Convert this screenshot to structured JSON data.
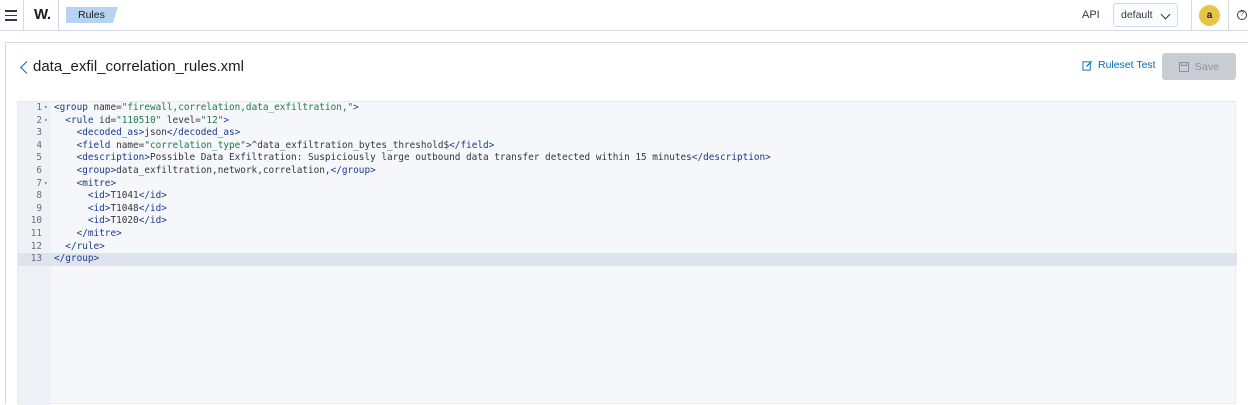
{
  "header": {
    "logo": "W.",
    "breadcrumb": "Rules",
    "api_label": "API",
    "selected_api": "default",
    "avatar_letter": "a",
    "help_glyph": "?"
  },
  "file": {
    "title": "data_exfil_correlation_rules.xml",
    "ruleset_test_label": "Ruleset Test",
    "save_label": "Save"
  },
  "editor": {
    "active_line": 13,
    "lines": [
      {
        "n": "1",
        "fold": true,
        "tokens": [
          [
            "tag",
            "<group "
          ],
          [
            "attr",
            "name="
          ],
          [
            "str",
            "\"firewall,correlation,data_exfiltration,\""
          ],
          [
            "tag",
            ">"
          ]
        ]
      },
      {
        "n": "2",
        "fold": true,
        "tokens": [
          [
            "txt",
            "  "
          ],
          [
            "tag",
            "<rule "
          ],
          [
            "attr",
            "id="
          ],
          [
            "str",
            "\"110510\""
          ],
          [
            "attr",
            " level="
          ],
          [
            "str",
            "\"12\""
          ],
          [
            "tag",
            ">"
          ]
        ]
      },
      {
        "n": "3",
        "fold": false,
        "tokens": [
          [
            "txt",
            "    "
          ],
          [
            "tag",
            "<decoded_as>"
          ],
          [
            "txt",
            "json"
          ],
          [
            "tag",
            "</decoded_as>"
          ]
        ]
      },
      {
        "n": "4",
        "fold": false,
        "tokens": [
          [
            "txt",
            "    "
          ],
          [
            "tag",
            "<field "
          ],
          [
            "attr",
            "name="
          ],
          [
            "str",
            "\"correlation_type\""
          ],
          [
            "tag",
            ">"
          ],
          [
            "txt",
            "^data_exfiltration_bytes_threshold$"
          ],
          [
            "tag",
            "</field>"
          ]
        ]
      },
      {
        "n": "5",
        "fold": false,
        "tokens": [
          [
            "txt",
            "    "
          ],
          [
            "tag",
            "<description>"
          ],
          [
            "txt",
            "Possible Data Exfiltration: Suspiciously large outbound data transfer detected within 15 minutes"
          ],
          [
            "tag",
            "</description>"
          ]
        ]
      },
      {
        "n": "6",
        "fold": false,
        "tokens": [
          [
            "txt",
            "    "
          ],
          [
            "tag",
            "<group>"
          ],
          [
            "txt",
            "data_exfiltration,network,correlation,"
          ],
          [
            "tag",
            "</group>"
          ]
        ]
      },
      {
        "n": "7",
        "fold": true,
        "tokens": [
          [
            "txt",
            "    "
          ],
          [
            "tag",
            "<mitre>"
          ]
        ]
      },
      {
        "n": "8",
        "fold": false,
        "tokens": [
          [
            "txt",
            "      "
          ],
          [
            "tag",
            "<id>"
          ],
          [
            "txt",
            "T1041"
          ],
          [
            "tag",
            "</id>"
          ]
        ]
      },
      {
        "n": "9",
        "fold": false,
        "tokens": [
          [
            "txt",
            "      "
          ],
          [
            "tag",
            "<id>"
          ],
          [
            "txt",
            "T1048"
          ],
          [
            "tag",
            "</id>"
          ]
        ]
      },
      {
        "n": "10",
        "fold": false,
        "tokens": [
          [
            "txt",
            "      "
          ],
          [
            "tag",
            "<id>"
          ],
          [
            "txt",
            "T1020"
          ],
          [
            "tag",
            "</id>"
          ]
        ]
      },
      {
        "n": "11",
        "fold": false,
        "tokens": [
          [
            "txt",
            "    "
          ],
          [
            "tag",
            "</mitre>"
          ]
        ]
      },
      {
        "n": "12",
        "fold": false,
        "tokens": [
          [
            "txt",
            "  "
          ],
          [
            "tag",
            "</rule>"
          ]
        ]
      },
      {
        "n": "13",
        "fold": false,
        "tokens": [
          [
            "tag",
            "</group>"
          ]
        ]
      }
    ]
  }
}
